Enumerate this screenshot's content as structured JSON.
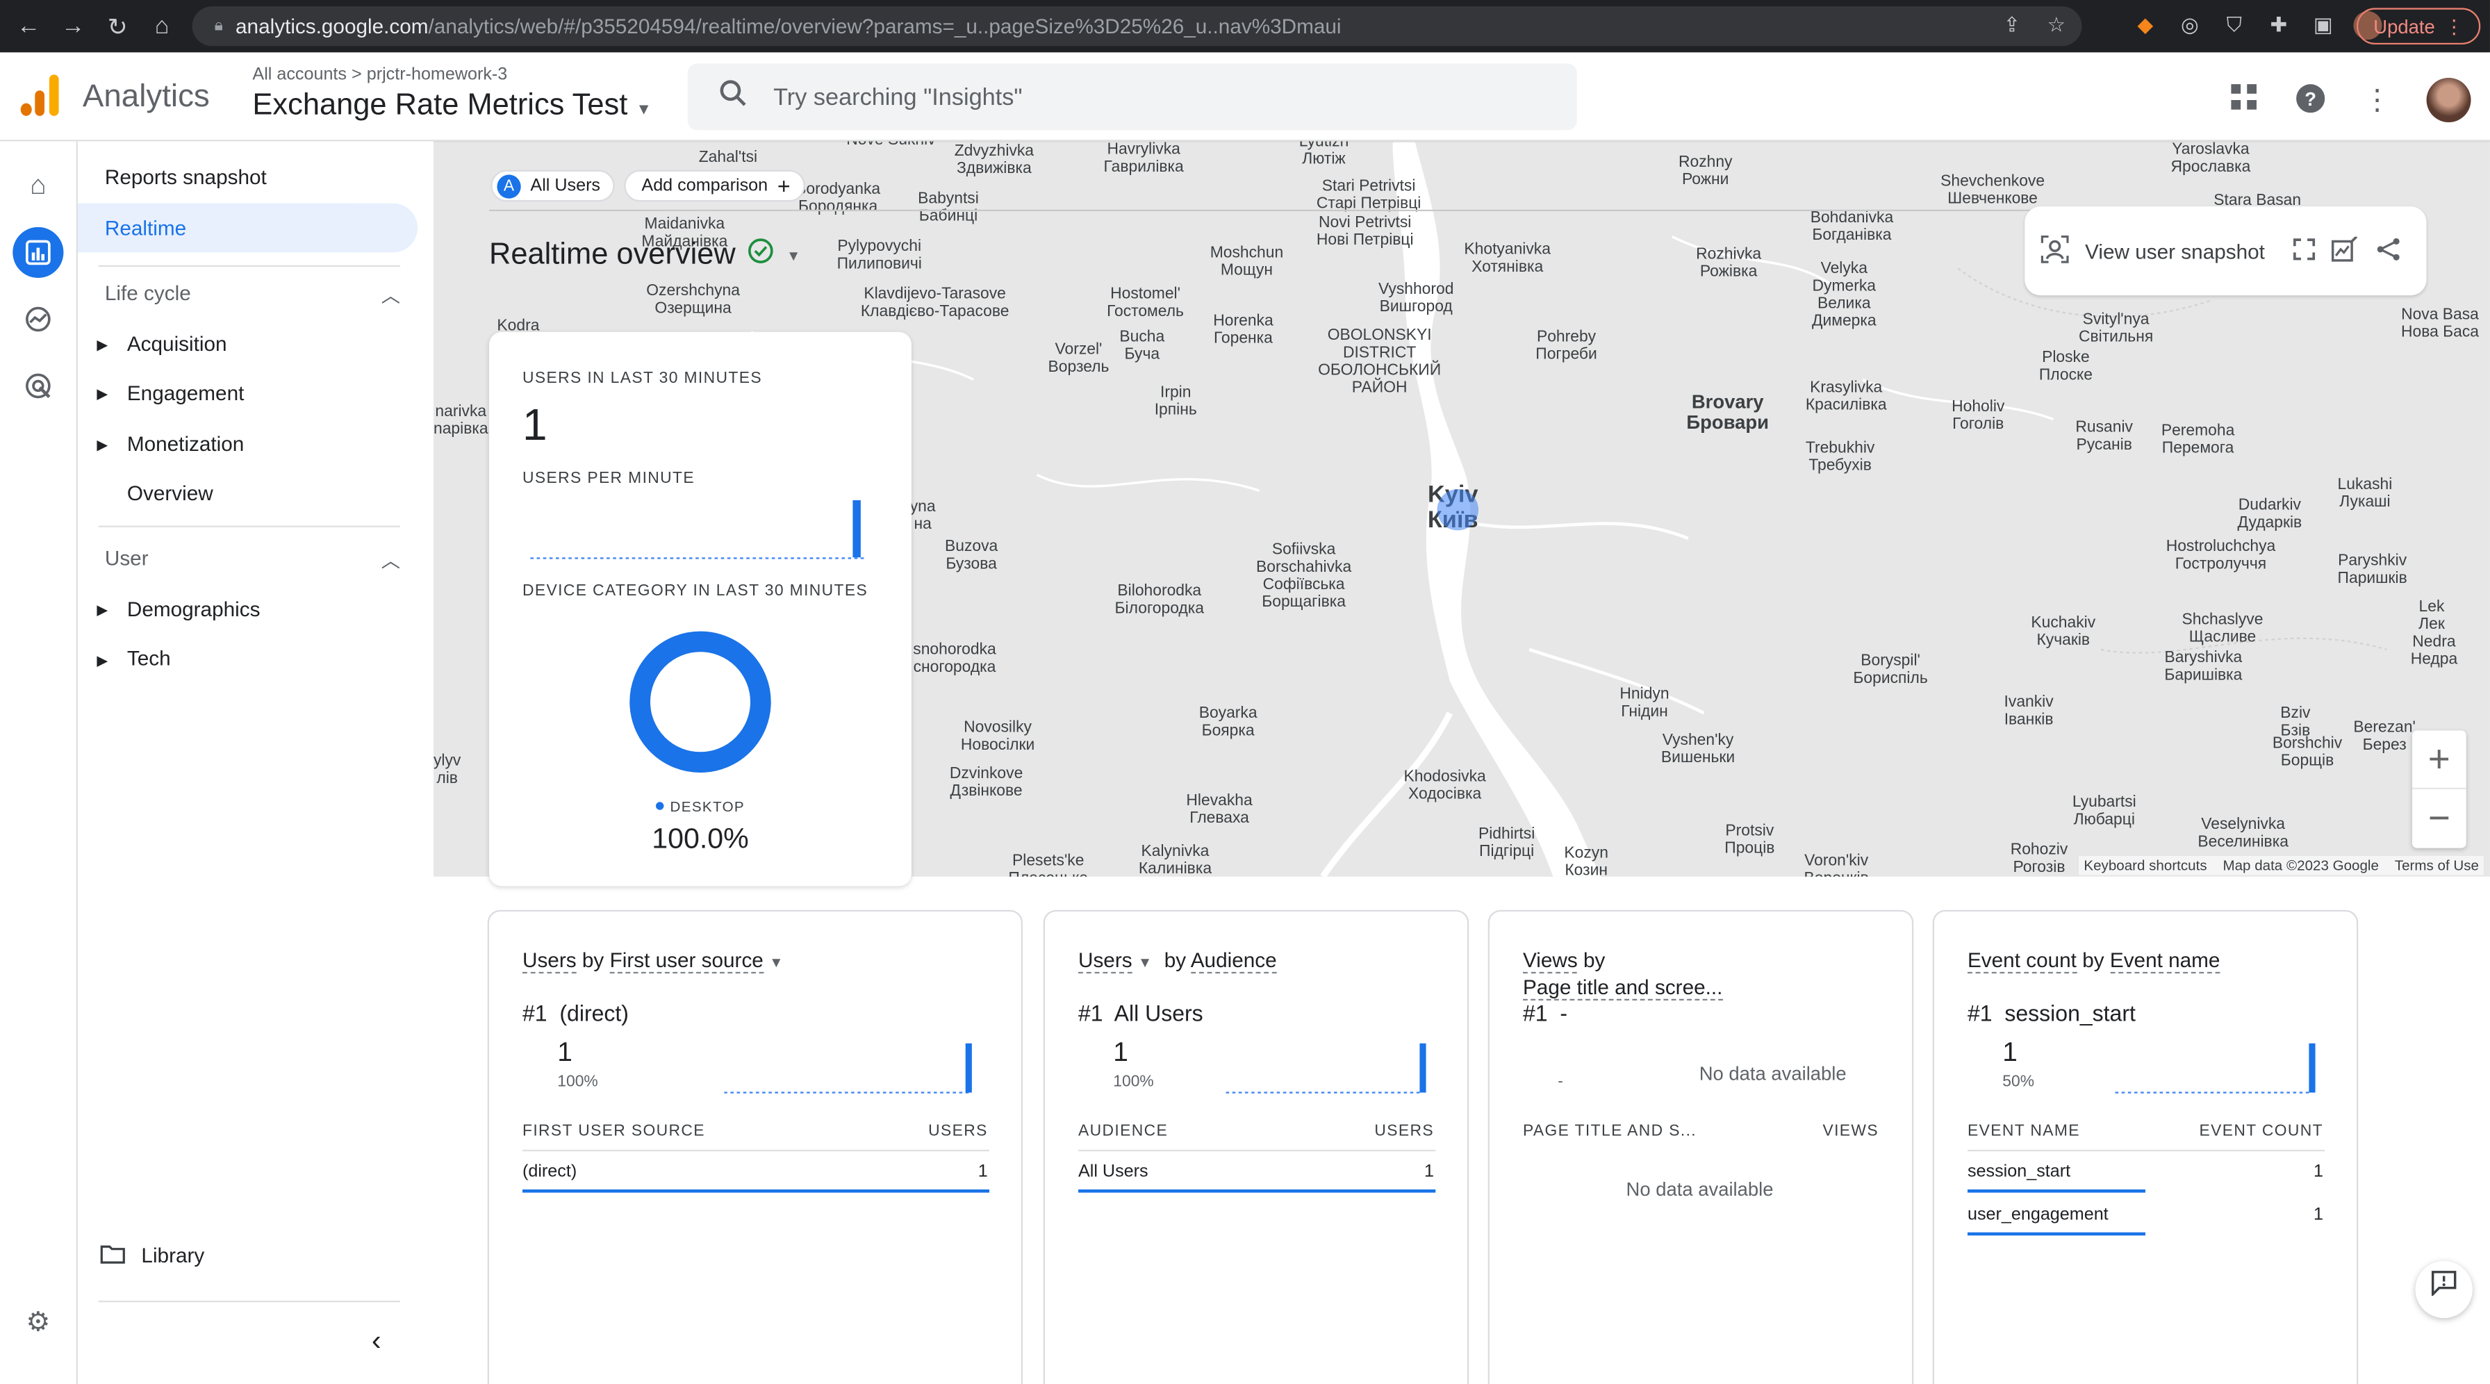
{
  "browser": {
    "url_host": "analytics.google.com",
    "url_path": "/analytics/web/#/p355204594/realtime/overview?params=_u..pageSize%3D25%26_u..nav%3Dmaui",
    "update_label": "Update"
  },
  "header": {
    "app_name": "Analytics",
    "crumb_accounts": "All accounts",
    "crumb_sep": ">",
    "crumb_account": "prjctr-homework-3",
    "property_name": "Exchange Rate Metrics Test",
    "search_placeholder": "Try searching \"Insights\""
  },
  "sidebar": {
    "reports_snapshot": "Reports snapshot",
    "realtime": "Realtime",
    "lifecycle_title": "Life cycle",
    "lifecycle_items": [
      "Acquisition",
      "Engagement",
      "Monetization",
      "Overview"
    ],
    "user_title": "User",
    "user_items": [
      "Demographics",
      "Tech"
    ],
    "library": "Library"
  },
  "map": {
    "chip_letter": "A",
    "chip_all_users": "All Users",
    "add_comparison": "Add comparison",
    "title": "Realtime overview",
    "snapshot_label": "View user snapshot",
    "zoom_in": "+",
    "zoom_out": "−",
    "footer": [
      "Keyboard shortcuts",
      "Map data ©2023 Google",
      "Terms of Use"
    ],
    "places": [
      {
        "t": "Zahal'tsi",
        "cls": ""
      },
      {
        "t": "Nove Sukhiv",
        "cls": ""
      },
      {
        "t": "Zdvyzhivka\nЗдвижівка",
        "cls": ""
      },
      {
        "t": "Havrylivka\nГаврилівка",
        "cls": ""
      },
      {
        "t": "Lyutizh\nЛютіж",
        "cls": ""
      },
      {
        "t": "Stari Petrivtsi\nСтарі Петрівці",
        "cls": ""
      },
      {
        "t": "Novi Petrivtsi\nНові Петрівці",
        "cls": ""
      },
      {
        "t": "Rozhny\nРожни",
        "cls": ""
      },
      {
        "t": "Shevchenkove\nШевченкове",
        "cls": ""
      },
      {
        "t": "Yaroslavka\nЯрославка",
        "cls": ""
      },
      {
        "t": "Stara Basan",
        "cls": ""
      },
      {
        "t": "Borodyanka\nБородянка",
        "cls": ""
      },
      {
        "t": "Babyntsi\nБабинці",
        "cls": ""
      },
      {
        "t": "Maidanivka\nМайданівка",
        "cls": ""
      },
      {
        "t": "Pylypovychi\nПилиповичі",
        "cls": ""
      },
      {
        "t": "Bohdanivka\nБогданівка",
        "cls": ""
      },
      {
        "t": "Khotyanivka\nХотянівка",
        "cls": ""
      },
      {
        "t": "Rozhivka\nРожівка",
        "cls": ""
      },
      {
        "t": "Moshchun\nМощун",
        "cls": ""
      },
      {
        "t": "Velyka\nDymerka\nВелика\nДимерка",
        "cls": ""
      },
      {
        "t": "Ozershchyna\nОзерщина",
        "cls": ""
      },
      {
        "t": "Klavdijevo-Tarasove\nКлавдієво-Тарасове",
        "cls": ""
      },
      {
        "t": "Hostomel'\nГостомель",
        "cls": ""
      },
      {
        "t": "Vyshhorod\nВишгород",
        "cls": ""
      },
      {
        "t": "Svityl'nya\nСвітильня",
        "cls": ""
      },
      {
        "t": "Nova Basa\nНова Баса",
        "cls": ""
      },
      {
        "t": "Kodra",
        "cls": ""
      },
      {
        "t": "Vorzel'\nВорзель",
        "cls": ""
      },
      {
        "t": "Bucha\nБуча",
        "cls": ""
      },
      {
        "t": "Horenka\nГоренка",
        "cls": ""
      },
      {
        "t": "OBOLONSKYI\nDISTRICT\nОБОЛОНСЬКИЙ\nРАЙОН",
        "cls": ""
      },
      {
        "t": "Pohreby\nПогреби",
        "cls": ""
      },
      {
        "t": "Ploske\nПлоске",
        "cls": ""
      },
      {
        "t": "Irpin\nІрпінь",
        "cls": ""
      },
      {
        "t": "Brovary\nБровари",
        "cls": "big"
      },
      {
        "t": "Krasylivka\nКрасилівка",
        "cls": ""
      },
      {
        "t": "Hoholiv\nГоголів",
        "cls": ""
      },
      {
        "t": "Rusaniv\nРусанів",
        "cls": ""
      },
      {
        "t": "Peremoha\nПеремога",
        "cls": ""
      },
      {
        "t": "Trebukhiv\nТребухів",
        "cls": ""
      },
      {
        "t": "narivka\nnарівка",
        "cls": ""
      },
      {
        "t": "Lukashi\nЛукаші",
        "cls": ""
      },
      {
        "t": "Kyiv\nКиїв",
        "cls": "city"
      },
      {
        "t": "Dudarkiv\nДударків",
        "cls": ""
      },
      {
        "t": "yna\nна",
        "cls": ""
      },
      {
        "t": "Buzova\nБузова",
        "cls": ""
      },
      {
        "t": "Sofiivska\nBorschahivka\nСофіївська\nБорщагівка",
        "cls": ""
      },
      {
        "t": "Hostroluchchya\nГостролуччя",
        "cls": ""
      },
      {
        "t": "Paryshkiv\nПаришків",
        "cls": ""
      },
      {
        "t": "Bilohorodka\nБілогородка",
        "cls": ""
      },
      {
        "t": "Shchaslyve\nЩасливе",
        "cls": ""
      },
      {
        "t": "Kuchakiv\nКучаків",
        "cls": ""
      },
      {
        "t": "Lek\nЛек",
        "cls": ""
      },
      {
        "t": "Nedra\nНедра",
        "cls": ""
      },
      {
        "t": "snohorodka\nсногородка",
        "cls": ""
      },
      {
        "t": "Boryspil'\nБориспіль",
        "cls": ""
      },
      {
        "t": "Baryshivka\nБаришівка",
        "cls": ""
      },
      {
        "t": "Hnidyn\nГнідин",
        "cls": ""
      },
      {
        "t": "Ivankiv\nІванків",
        "cls": ""
      },
      {
        "t": "Boyarka\nБоярка",
        "cls": ""
      },
      {
        "t": "Bziv\nБзів",
        "cls": ""
      },
      {
        "t": "Berezan'\nБерез",
        "cls": ""
      },
      {
        "t": "Novosilky\nНовосілки",
        "cls": ""
      },
      {
        "t": "Vyshen'ky\nВишеньки",
        "cls": ""
      },
      {
        "t": "Borshchiv\nБорщів",
        "cls": ""
      },
      {
        "t": "ylyv\nлів",
        "cls": ""
      },
      {
        "t": "Dzvinkove\nДзвінкове",
        "cls": ""
      },
      {
        "t": "Khodosivka\nХодосівка",
        "cls": ""
      },
      {
        "t": "Hlevakha\nГлеваха",
        "cls": ""
      },
      {
        "t": "Lyubartsi\nЛюбарці",
        "cls": ""
      },
      {
        "t": "Veselynivka\nВеселинівка",
        "cls": ""
      },
      {
        "t": "Pidhirtsi\nПідгірці",
        "cls": ""
      },
      {
        "t": "Protsiv\nПроців",
        "cls": ""
      },
      {
        "t": "Rohoziv\nРогозів",
        "cls": ""
      },
      {
        "t": "Kalynivka\nКалинівка",
        "cls": ""
      },
      {
        "t": "Plesets'ke\nПлесецьке",
        "cls": ""
      },
      {
        "t": "Kozyn\nКозин",
        "cls": ""
      },
      {
        "t": "Voron'kiv\nВоронків",
        "cls": ""
      }
    ]
  },
  "overview": {
    "users_30_label": "USERS IN LAST 30 MINUTES",
    "users_30_value": "1",
    "per_minute_label": "USERS PER MINUTE",
    "per_minute_values": [
      0,
      0,
      0,
      0,
      0,
      0,
      0,
      0,
      0,
      0,
      0,
      0,
      0,
      0,
      0,
      0,
      0,
      0,
      0,
      0,
      0,
      0,
      0,
      0,
      0,
      0,
      0,
      0,
      0,
      1
    ],
    "device_label": "DEVICE CATEGORY IN LAST 30 MINUTES",
    "device_legend": "DESKTOP",
    "device_percent": "100.0%",
    "device_share": 1.0
  },
  "cards": {
    "source": {
      "title_metric": "Users",
      "title_by": "by",
      "title_dim": "First user source",
      "rank": "#1",
      "top_name": "(direct)",
      "top_value": "1",
      "top_pct": "100%",
      "col1": "FIRST USER SOURCE",
      "col2": "USERS",
      "rows": [
        {
          "name": "(direct)",
          "value": "1",
          "share": 1.0
        }
      ]
    },
    "audience": {
      "title_metric": "Users",
      "title_by": "by",
      "title_dim": "Audience",
      "rank": "#1",
      "top_name": "All Users",
      "top_value": "1",
      "top_pct": "100%",
      "col1": "AUDIENCE",
      "col2": "USERS",
      "rows": [
        {
          "name": "All Users",
          "value": "1",
          "share": 1.0
        }
      ]
    },
    "views": {
      "title_metric": "Views",
      "title_by": "by",
      "title_dim": "Page title and scree...",
      "rank": "#1",
      "top_name": "-",
      "top_dash": "-",
      "no_data_chart": "No data available",
      "col1": "PAGE TITLE AND S...",
      "col2": "VIEWS",
      "no_data_table": "No data available"
    },
    "events": {
      "title_metric": "Event count",
      "title_by": "by",
      "title_dim": "Event name",
      "rank": "#1",
      "top_name": "session_start",
      "top_value": "1",
      "top_pct": "50%",
      "col1": "EVENT NAME",
      "col2": "EVENT COUNT",
      "rows": [
        {
          "name": "session_start",
          "value": "1",
          "share": 0.5
        },
        {
          "name": "user_engagement",
          "value": "1",
          "share": 0.5
        }
      ]
    }
  },
  "colors": {
    "accent": "#1a73e8",
    "logo_orange": "#f9ab00",
    "logo_dark_orange": "#e37400",
    "map_land": "#e7e7e7",
    "map_water": "#ffffff",
    "chrome_dark": "#202124"
  }
}
